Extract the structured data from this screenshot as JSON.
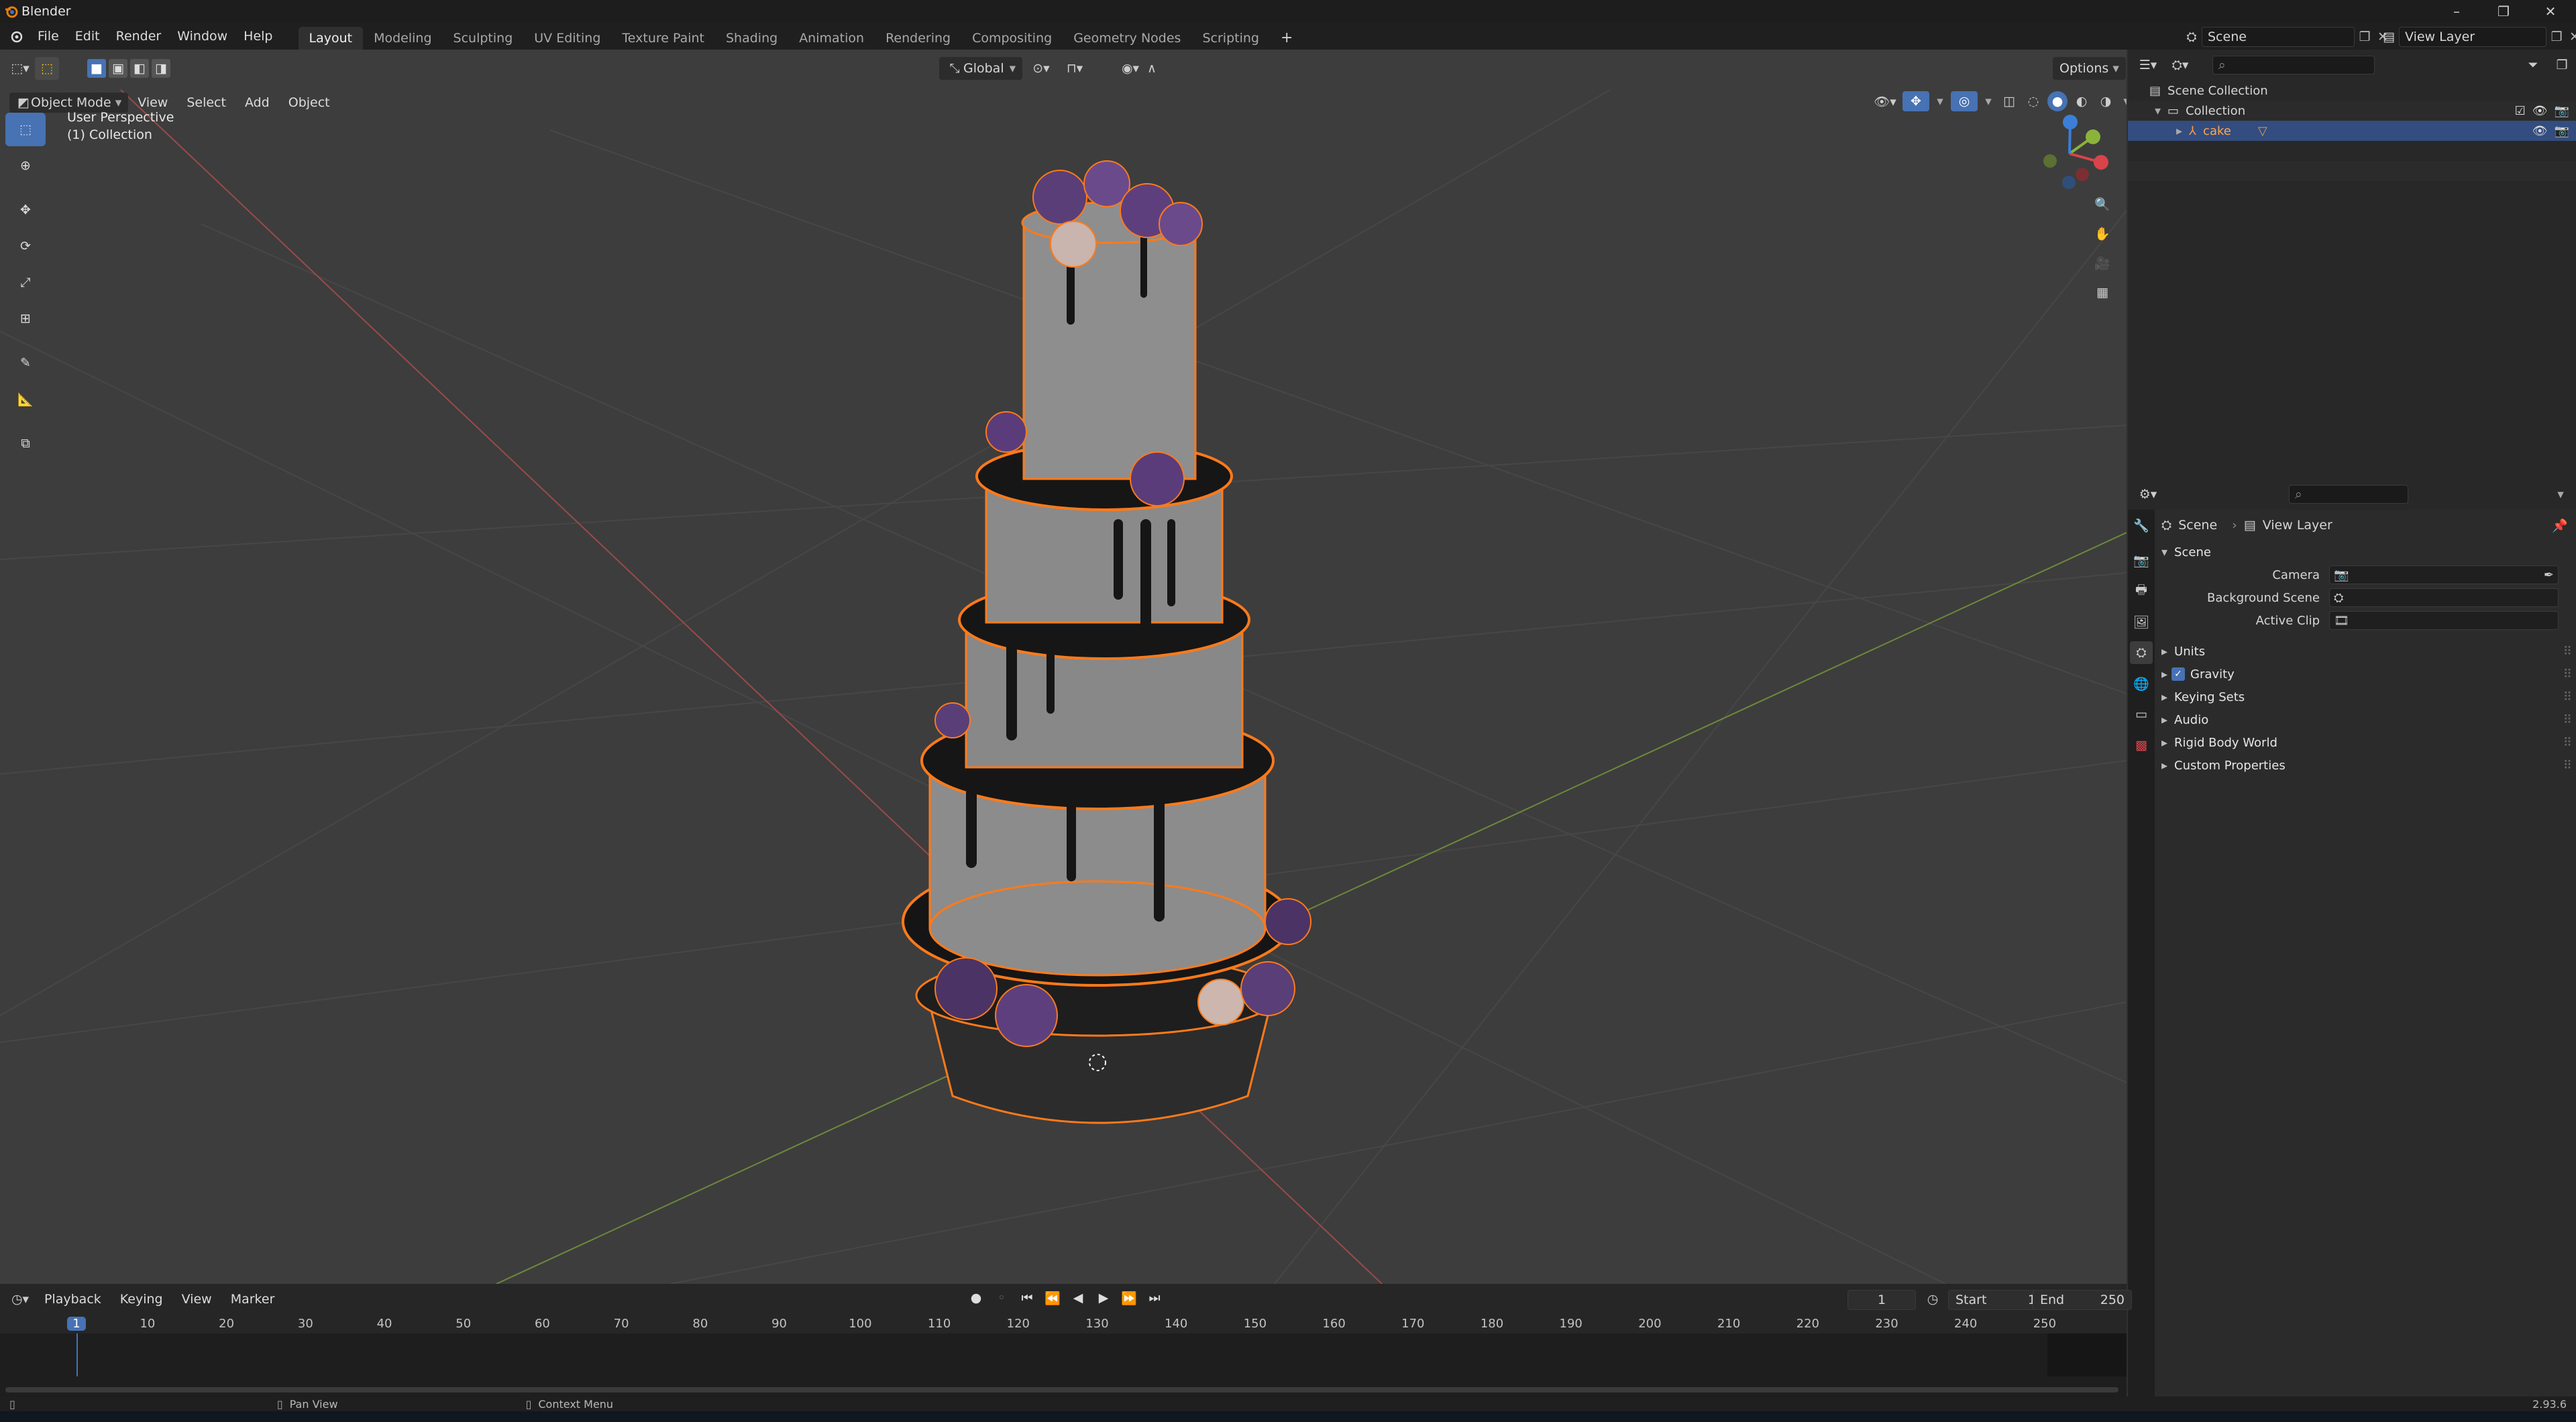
{
  "app": {
    "title": "Blender",
    "version": "2.93.6"
  },
  "menus": [
    "File",
    "Edit",
    "Render",
    "Window",
    "Help"
  ],
  "workspaces": [
    "Layout",
    "Modeling",
    "Sculpting",
    "UV Editing",
    "Texture Paint",
    "Shading",
    "Animation",
    "Rendering",
    "Compositing",
    "Geometry Nodes",
    "Scripting"
  ],
  "active_workspace": "Layout",
  "scene_field": "Scene",
  "view_layer_field": "View Layer",
  "viewport": {
    "mode": "Object Mode",
    "menu": [
      "View",
      "Select",
      "Add",
      "Object"
    ],
    "transform_orientation": "Global",
    "options_label": "Options",
    "overlay_line1": "User Perspective",
    "overlay_line2": "(1) Collection"
  },
  "outliner": {
    "rows": [
      {
        "label": "Scene Collection"
      },
      {
        "label": "Collection"
      },
      {
        "label": "cake"
      }
    ]
  },
  "properties": {
    "breadcrumb_scene": "Scene",
    "breadcrumb_layer": "View Layer",
    "panel_scene": "Scene",
    "fields": [
      {
        "label": "Camera"
      },
      {
        "label": "Background Scene"
      },
      {
        "label": "Active Clip"
      }
    ],
    "subpanels": [
      "Units",
      "Gravity",
      "Keying Sets",
      "Audio",
      "Rigid Body World",
      "Custom Properties"
    ]
  },
  "timeline": {
    "menus": [
      "Playback",
      "Keying",
      "View",
      "Marker"
    ],
    "current_frame": "1",
    "start_label": "Start",
    "start_value": "1",
    "end_label": "End",
    "end_value": "250",
    "ticks": [
      "1",
      "10",
      "20",
      "30",
      "40",
      "50",
      "60",
      "70",
      "80",
      "90",
      "100",
      "110",
      "120",
      "130",
      "140",
      "150",
      "160",
      "170",
      "180",
      "190",
      "200",
      "210",
      "220",
      "230",
      "240",
      "250"
    ]
  },
  "status": {
    "pan_view": "Pan View",
    "context_menu": "Context Menu"
  },
  "colors": {
    "accent": "#4772b3",
    "selection_outline": "#ff7a1a",
    "active_frame": "#4772b3"
  }
}
